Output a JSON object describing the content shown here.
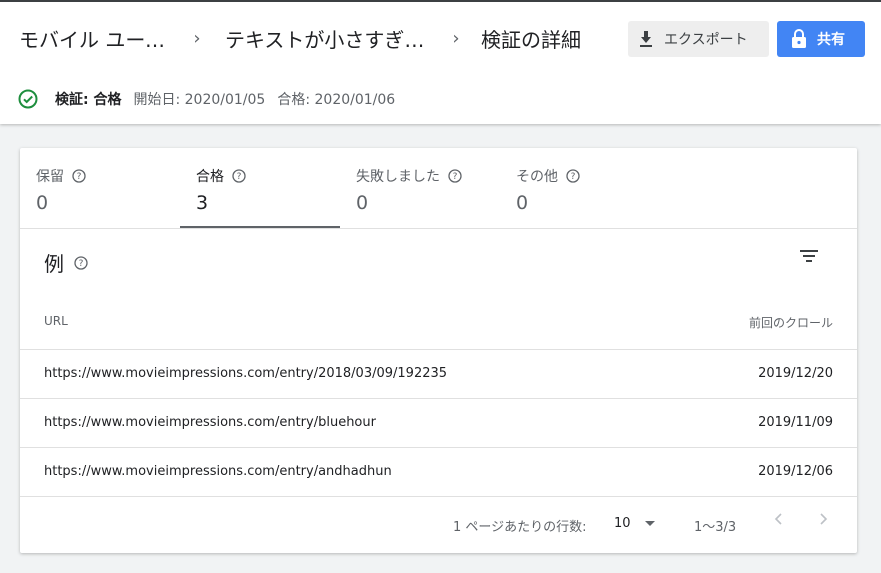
{
  "header": {
    "breadcrumbs": [
      "モバイル ユーザビリティ",
      "テキストが小さすぎて読めません",
      "検証の詳細"
    ],
    "export_label": "エクスポート",
    "share_label": "共有"
  },
  "status": {
    "label": "検証: 合格",
    "start_date": "開始日: 2020/01/05",
    "pass_date": "合格: 2020/01/06"
  },
  "tabs": [
    {
      "label": "保留",
      "value": "0"
    },
    {
      "label": "合格",
      "value": "3"
    },
    {
      "label": "失敗しました",
      "value": "0"
    },
    {
      "label": "その他",
      "value": "0"
    }
  ],
  "examples": {
    "title": "例",
    "col_url": "URL",
    "col_crawl": "前回のクロール",
    "rows": [
      {
        "url": "https://www.movieimpressions.com/entry/2018/03/09/192235",
        "date": "2019/12/20"
      },
      {
        "url": "https://www.movieimpressions.com/entry/bluehour",
        "date": "2019/11/09"
      },
      {
        "url": "https://www.movieimpressions.com/entry/andhadhun",
        "date": "2019/12/06"
      }
    ]
  },
  "pager": {
    "rows_per_page_label": "1 ページあたりの行数:",
    "rows_per_page_value": "10",
    "range": "1～3/3"
  },
  "colors": {
    "accent": "#4285f4",
    "success": "#1e8e3e"
  }
}
